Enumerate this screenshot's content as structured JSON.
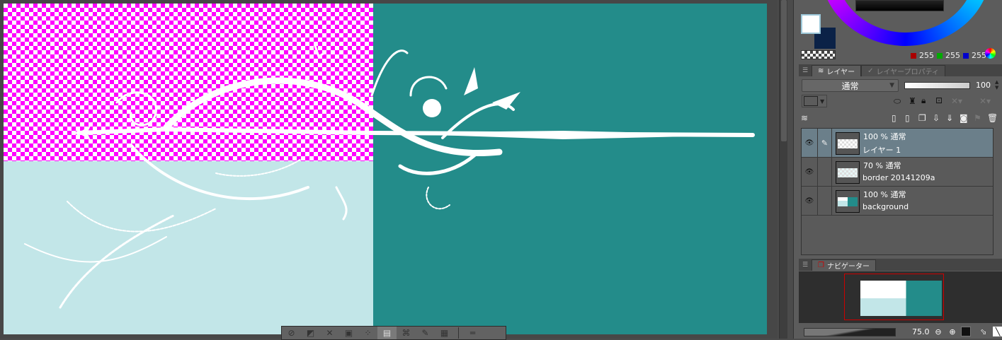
{
  "color": {
    "fg": "#ffffff",
    "bg": "#0b2247",
    "r": "255",
    "g": "255",
    "b": "255"
  },
  "layer_panel": {
    "tabs": [
      {
        "label": "レイヤー"
      },
      {
        "label": "レイヤープロパティ"
      }
    ],
    "blend_mode": "通常",
    "opacity": "100",
    "layers": [
      {
        "info": "100 % 通常",
        "name": "レイヤー 1",
        "selected": true
      },
      {
        "info": "70 % 通常",
        "name": "border 20141209a",
        "selected": false
      },
      {
        "info": "100 % 通常",
        "name": "background",
        "selected": false
      }
    ]
  },
  "navigator": {
    "tab_label": "ナビゲーター",
    "zoom": "75.0"
  },
  "canvas_colors": {
    "magenta": "#ff00ff",
    "light": "#c2e6e8",
    "teal": "#238c8a"
  }
}
